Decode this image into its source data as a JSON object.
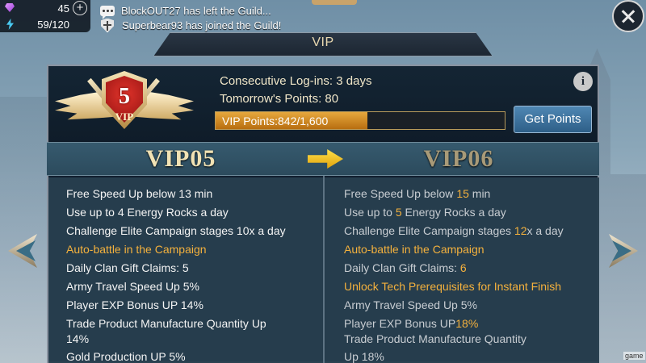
{
  "resources": {
    "gems": "45",
    "energy": "59/120"
  },
  "feed": {
    "items": [
      "BlockOUT27 has left the Guild...",
      "Superbear93 has joined the Guild!"
    ]
  },
  "header": {
    "title": "VIP"
  },
  "vip_status": {
    "badge_level": "5",
    "badge_label": "VIP",
    "consecutive_logins": "Consecutive Log-ins: 3 days",
    "tomorrow_points": "Tomorrow's Points: 80",
    "progress_text": "VIP Points:842/1,600",
    "progress_fraction": 0.526,
    "get_points_label": "Get Points",
    "info_label": "i"
  },
  "levels": {
    "current": "VIP05",
    "next": "VIP06"
  },
  "colors": {
    "accent_orange": "#f4b13d",
    "panel_bg": "#122030",
    "button_blue": "#3b6f99"
  },
  "current_benefits": [
    {
      "text": "Free Speed Up below 13 min",
      "style": "w"
    },
    {
      "text": "Use up to 4 Energy Rocks a day",
      "style": "w"
    },
    {
      "text": "Challenge Elite Campaign stages 10x a day",
      "style": "w"
    },
    {
      "text": "Auto-battle in the Campaign",
      "style": "o"
    },
    {
      "text": "Daily Clan Gift Claims: 5",
      "style": "w"
    },
    {
      "text": "Army Travel Speed Up 5%",
      "style": "w"
    },
    {
      "text": "Player EXP Bonus UP 14%",
      "style": "w"
    },
    {
      "text": "Trade Product Manufacture Quantity Up",
      "style": "w"
    },
    {
      "text": "14%",
      "style": "w"
    },
    {
      "text": "Gold Production UP 5%",
      "style": "w"
    }
  ],
  "next_benefits": [
    {
      "parts": [
        {
          "t": "Free Speed Up below ",
          "c": "g"
        },
        {
          "t": "15",
          "c": "hl"
        },
        {
          "t": " min",
          "c": "g"
        }
      ]
    },
    {
      "parts": [
        {
          "t": "Use up to ",
          "c": "g"
        },
        {
          "t": "5",
          "c": "hl"
        },
        {
          "t": " Energy Rocks a day",
          "c": "g"
        }
      ]
    },
    {
      "parts": [
        {
          "t": "Challenge Elite Campaign stages ",
          "c": "g"
        },
        {
          "t": "12",
          "c": "hl"
        },
        {
          "t": "x a day",
          "c": "g"
        }
      ]
    },
    {
      "parts": [
        {
          "t": "Auto-battle in the Campaign",
          "c": "o"
        }
      ]
    },
    {
      "parts": [
        {
          "t": "Daily Clan Gift Claims: ",
          "c": "g"
        },
        {
          "t": "6",
          "c": "hl"
        }
      ]
    },
    {
      "parts": [
        {
          "t": "Unlock Tech Prerequisites for Instant Finish",
          "c": "o"
        }
      ]
    },
    {
      "parts": [
        {
          "t": "Army Travel Speed Up 5%",
          "c": "g"
        }
      ]
    },
    {
      "parts": [
        {
          "t": "Player EXP Bonus UP",
          "c": "g"
        },
        {
          "t": "18%",
          "c": "hl"
        }
      ]
    },
    {
      "parts": [
        {
          "t": "Trade Product Manufacture Quantity",
          "c": "g"
        }
      ]
    },
    {
      "parts": [
        {
          "t": "Up 18%",
          "c": "g"
        }
      ]
    }
  ],
  "watermark": "game"
}
